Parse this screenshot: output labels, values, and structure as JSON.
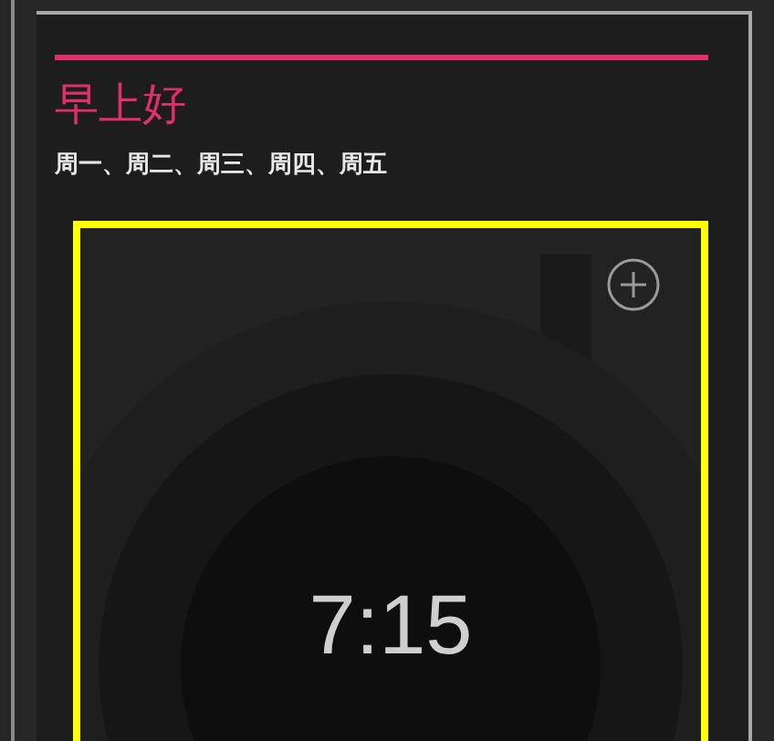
{
  "alarm": {
    "title": "早上好",
    "days": "周一、周二、周三、周四、周五",
    "time": "7:15",
    "highlighted": true
  }
}
